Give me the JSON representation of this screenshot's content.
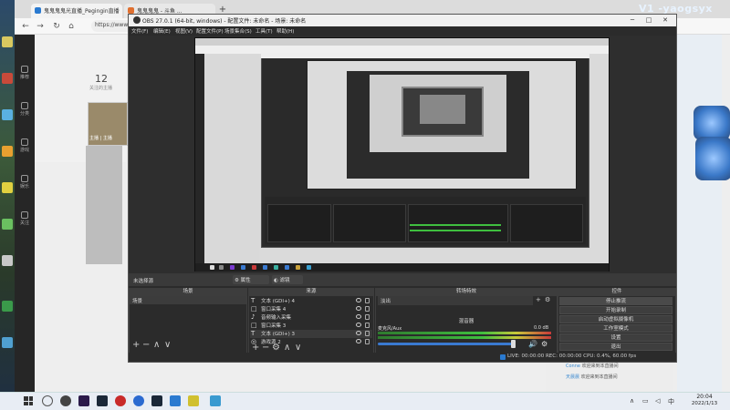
{
  "watermark": "V1 -yaogsyx",
  "browser": {
    "tabs": [
      {
        "label": "鬼鬼鬼鬼光直播_Pegingin直播"
      },
      {
        "label": "鬼鬼鬼鬼 - 斗鱼 ..."
      }
    ],
    "new_tab": "+",
    "address": "https://www..."
  },
  "site": {
    "sidebar": [
      "推荐",
      "分类",
      "游戏",
      "娱乐",
      "关注"
    ],
    "follow_count": "12",
    "follow_label": "关注的主播",
    "avatar_caption": "主播 | 主播",
    "chat": [
      {
        "name": "Conne",
        "text": "欢迎来到本直播间"
      },
      {
        "name": "天晨晨",
        "text": "欢迎来到本直播间"
      }
    ]
  },
  "obs": {
    "title": "OBS 27.0.1 (64-bit, windows) - 配置文件: 未命名 - 场景: 未命名",
    "menu": [
      "文件(F)",
      "编辑(E)",
      "视图(V)",
      "配置文件(P)",
      "场景集合(S)",
      "工具(T)",
      "帮助(H)"
    ],
    "dock_bar": {
      "no_source": "未选择源",
      "properties": "⚙ 属性",
      "filters": "◐ 滤镜"
    },
    "docks": {
      "scenes_title": "场景",
      "sources_title": "来源",
      "transitions_title": "转场特效",
      "controls_title": "控件"
    },
    "scenes": [
      "场景"
    ],
    "sources": [
      {
        "icon": "T",
        "label": "文本 (GDI+) 4"
      },
      {
        "icon": "□",
        "label": "窗口采集 4"
      },
      {
        "icon": "♪",
        "label": "音频输入采集"
      },
      {
        "icon": "□",
        "label": "窗口采集 3"
      },
      {
        "icon": "T",
        "label": "文本 (GDI+) 3"
      },
      {
        "icon": "◎",
        "label": "游戏源 2"
      }
    ],
    "transition": "淡出",
    "mixer": {
      "title": "混音器",
      "channel": "麦克风/Aux",
      "db": "0.0 dB"
    },
    "controls": [
      "停止推流",
      "开始录制",
      "启动虚拟摄像机",
      "工作室模式",
      "设置",
      "退出"
    ],
    "status": "LIVE: 00:00:00  REC: 00:00:00  CPU: 0.4%, 60.00 fps"
  },
  "taskbar": {
    "time": "20:04",
    "date": "2022/1/13"
  }
}
